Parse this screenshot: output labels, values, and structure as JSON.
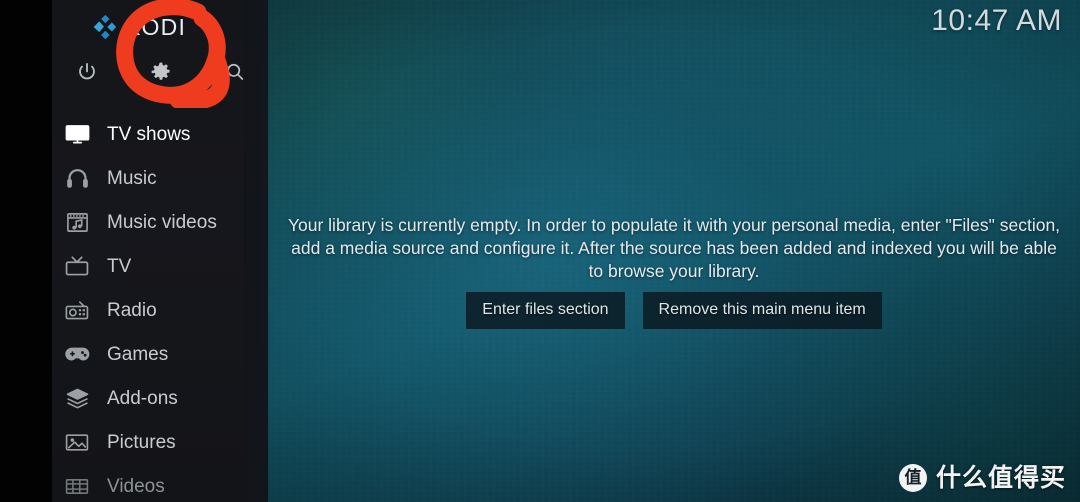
{
  "app": {
    "name": "KODI",
    "logo_icon": "kodi-logo-icon",
    "logo_color_light": "#3aa5dc",
    "logo_color_dark": "#1e7fb8"
  },
  "sidebar": {
    "top_icons": [
      {
        "name": "power-icon",
        "label": "Power"
      },
      {
        "name": "gear-icon",
        "label": "Settings"
      },
      {
        "name": "search-icon",
        "label": "Search"
      }
    ],
    "items": [
      {
        "label": "TV shows",
        "icon": "tv-monitor-icon",
        "state": "selected"
      },
      {
        "label": "Music",
        "icon": "headphones-icon",
        "state": "normal"
      },
      {
        "label": "Music videos",
        "icon": "music-video-icon",
        "state": "normal"
      },
      {
        "label": "TV",
        "icon": "retro-tv-icon",
        "state": "normal"
      },
      {
        "label": "Radio",
        "icon": "radio-icon",
        "state": "normal"
      },
      {
        "label": "Games",
        "icon": "gamepad-icon",
        "state": "normal"
      },
      {
        "label": "Add-ons",
        "icon": "addon-box-icon",
        "state": "normal"
      },
      {
        "label": "Pictures",
        "icon": "picture-icon",
        "state": "normal"
      },
      {
        "label": "Videos",
        "icon": "film-strip-icon",
        "state": "dim"
      }
    ]
  },
  "header": {
    "clock": "10:47 AM"
  },
  "main": {
    "empty_message": "Your library is currently empty. In order to populate it with your personal media, enter \"Files\" section, add a media source and configure it. After the source has been added and indexed you will be able to browse your library.",
    "buttons": [
      {
        "label": "Enter files section",
        "name": "enter-files-section-button"
      },
      {
        "label": "Remove this main menu item",
        "name": "remove-main-menu-item-button"
      }
    ]
  },
  "annotation": {
    "shape": "hand-drawn-circle",
    "target": "gear-icon",
    "color": "#f03c1e"
  },
  "watermark": {
    "badge_char": "值",
    "text": "什么值得买"
  },
  "theme": {
    "sidebar_bg": "#16171c",
    "background_teal": "#125565",
    "background_deep": "#0a2b38",
    "button_bg": "#0a161e",
    "text_primary": "#ffffff",
    "text_secondary": "#c9ccce"
  }
}
